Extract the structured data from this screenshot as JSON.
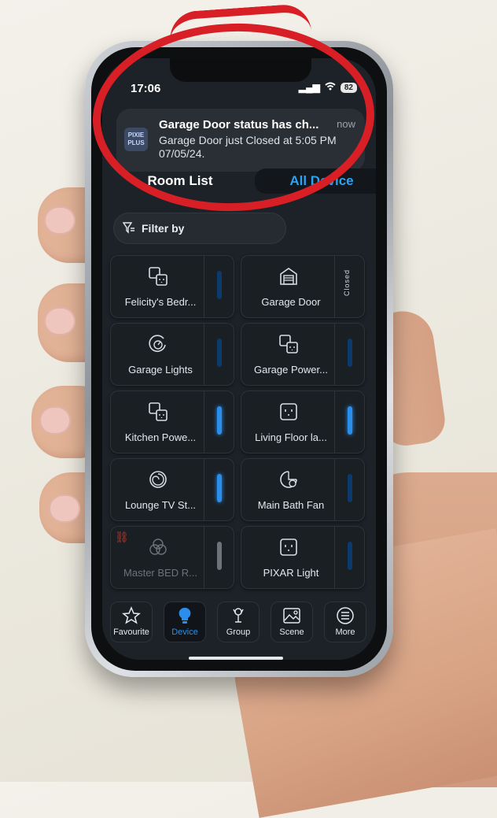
{
  "status_bar": {
    "time": "17:06",
    "battery": "82"
  },
  "notification": {
    "app_logo_text": "PIXIE PLUS",
    "title": "Garage Door status has ch...",
    "time": "now",
    "body": "Garage Door just Closed at 5:05 PM 07/05/24."
  },
  "tabs": [
    {
      "label": "Room List",
      "selected": false
    },
    {
      "label": "All Device",
      "selected": true
    }
  ],
  "filter": {
    "label": "Filter by"
  },
  "devices": [
    {
      "label": "Felicity's Bedr...",
      "icon": "double-socket-icon",
      "state": "off"
    },
    {
      "label": "Garage Door",
      "icon": "garage-icon",
      "state": "closed",
      "side_text": "Closed"
    },
    {
      "label": "Garage Lights",
      "icon": "dimmer-icon",
      "state": "off"
    },
    {
      "label": "Garage Power...",
      "icon": "double-socket-icon",
      "state": "off"
    },
    {
      "label": "Kitchen Powe...",
      "icon": "double-socket-icon",
      "state": "on"
    },
    {
      "label": "Living Floor la...",
      "icon": "socket-icon",
      "state": "on"
    },
    {
      "label": "Lounge TV St...",
      "icon": "swirl-icon",
      "state": "on"
    },
    {
      "label": "Main Bath Fan",
      "icon": "timer-switch-icon",
      "state": "off"
    },
    {
      "label": "Master BED R...",
      "icon": "rgb-light-icon",
      "state": "offline"
    },
    {
      "label": "PIXAR Light",
      "icon": "socket-icon",
      "state": "off"
    }
  ],
  "nav": [
    {
      "label": "Favourite",
      "icon": "star-icon",
      "active": false
    },
    {
      "label": "Device",
      "icon": "bulb-icon",
      "active": true
    },
    {
      "label": "Group",
      "icon": "group-icon",
      "active": false
    },
    {
      "label": "Scene",
      "icon": "scene-icon",
      "active": false
    },
    {
      "label": "More",
      "icon": "more-icon",
      "active": false
    }
  ],
  "colors": {
    "accent": "#2a8eea",
    "annotation": "#d81f26",
    "screen_bg": "#1d2228"
  }
}
